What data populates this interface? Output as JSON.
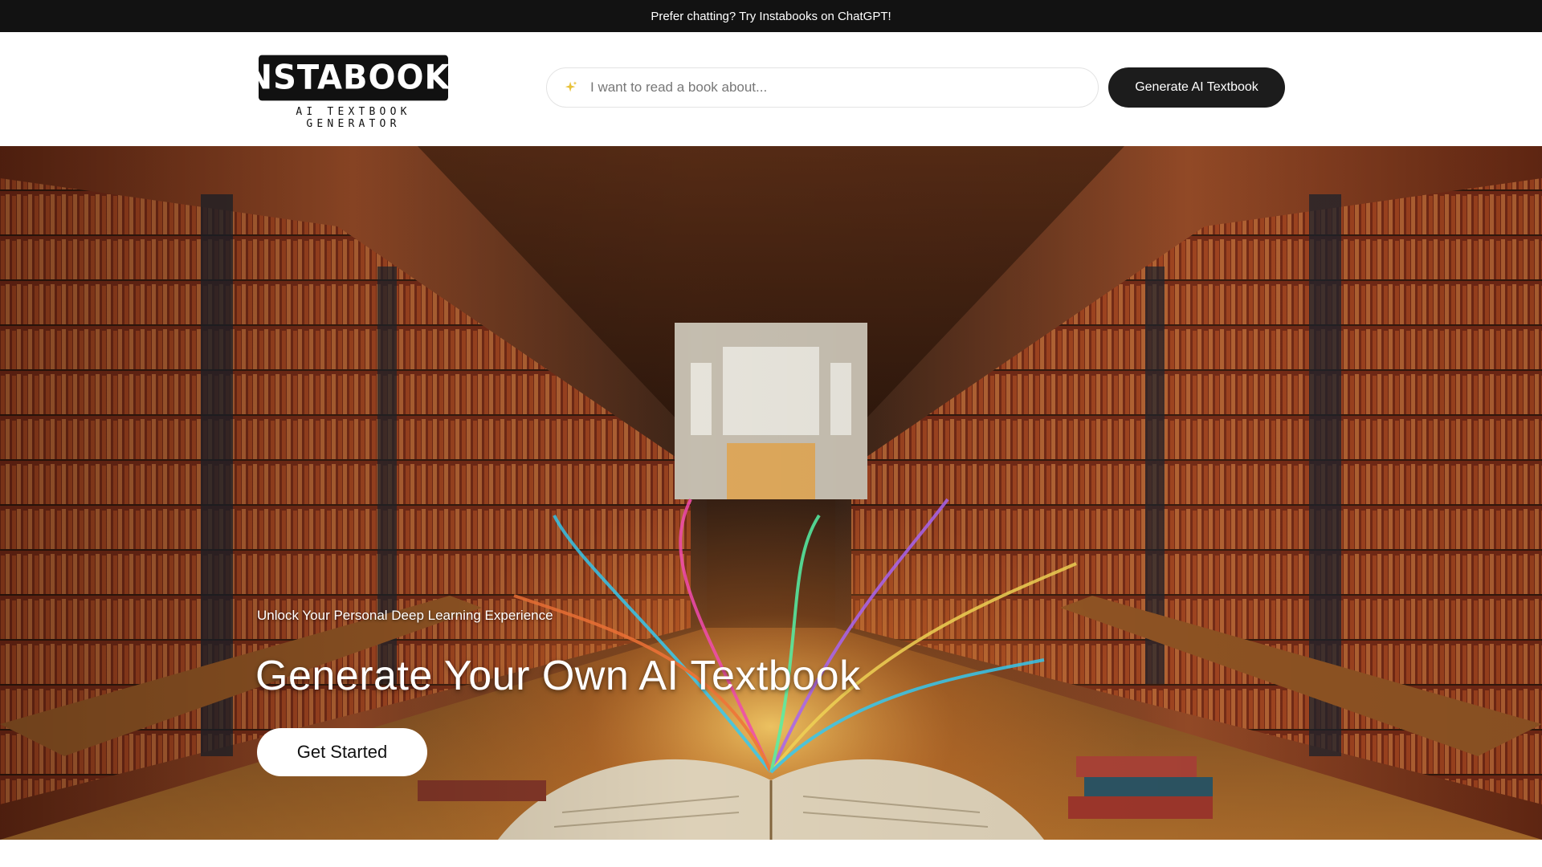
{
  "announcement": {
    "text": "Prefer chatting? Try Instabooks on ChatGPT!"
  },
  "header": {
    "logo_title": "INSTABOOKS",
    "logo_subtitle": "AI TEXTBOOK GENERATOR",
    "search": {
      "placeholder": "I want to read a book about...",
      "value": "",
      "icon": "sparkle-icon"
    },
    "generate_label": "Generate AI Textbook"
  },
  "hero": {
    "tagline": "Unlock Your Personal Deep Learning Experience",
    "headline": "Generate Your Own AI Textbook",
    "cta_label": "Get Started",
    "image": "library-with-glowing-open-book"
  },
  "colors": {
    "announcement_bg": "#121212",
    "button_dark": "#1c1c1c",
    "sparkle": "#e8c23a",
    "cta_bg": "#ffffff"
  }
}
